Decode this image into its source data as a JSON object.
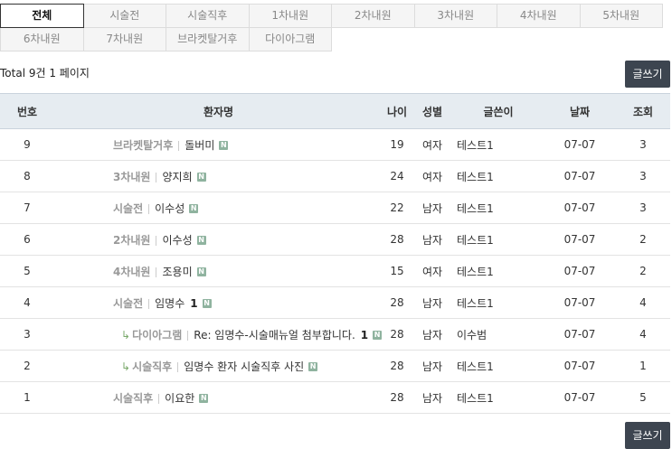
{
  "tabs": {
    "row1": [
      "전체",
      "시술전",
      "시술직후",
      "1차내원",
      "2차내원",
      "3차내원",
      "4차내원",
      "5차내원"
    ],
    "row2": [
      "6차내원",
      "7차내원",
      "브라켓탈거후",
      "다이아그램"
    ]
  },
  "total": "Total 9건 1 페이지",
  "write_button": "글쓰기",
  "table": {
    "headers": {
      "num": "번호",
      "name": "환자명",
      "age": "나이",
      "sex": "성별",
      "writer": "글쓴이",
      "date": "날짜",
      "views": "조회"
    },
    "rows": [
      {
        "num": "9",
        "cat": "브라켓탈거후",
        "title": "돌버미",
        "comments": "",
        "age": "19",
        "sex": "여자",
        "writer": "테스트1",
        "date": "07-07",
        "views": "3",
        "reply": false
      },
      {
        "num": "8",
        "cat": "3차내원",
        "title": "양지희",
        "comments": "",
        "age": "24",
        "sex": "여자",
        "writer": "테스트1",
        "date": "07-07",
        "views": "3",
        "reply": false
      },
      {
        "num": "7",
        "cat": "시술전",
        "title": "이수성",
        "comments": "",
        "age": "22",
        "sex": "남자",
        "writer": "테스트1",
        "date": "07-07",
        "views": "3",
        "reply": false
      },
      {
        "num": "6",
        "cat": "2차내원",
        "title": "이수성",
        "comments": "",
        "age": "28",
        "sex": "남자",
        "writer": "테스트1",
        "date": "07-07",
        "views": "2",
        "reply": false
      },
      {
        "num": "5",
        "cat": "4차내원",
        "title": "조용미",
        "comments": "",
        "age": "15",
        "sex": "여자",
        "writer": "테스트1",
        "date": "07-07",
        "views": "2",
        "reply": false
      },
      {
        "num": "4",
        "cat": "시술전",
        "title": "임명수",
        "comments": "1",
        "age": "28",
        "sex": "남자",
        "writer": "테스트1",
        "date": "07-07",
        "views": "4",
        "reply": false
      },
      {
        "num": "3",
        "cat": "다이아그램",
        "title": "Re: 임명수-시술매뉴얼 첨부합니다.",
        "comments": "1",
        "age": "28",
        "sex": "남자",
        "writer": "이수범",
        "date": "07-07",
        "views": "4",
        "reply": true
      },
      {
        "num": "2",
        "cat": "시술직후",
        "title": "임명수 환자 시술직후 사진",
        "comments": "",
        "age": "28",
        "sex": "남자",
        "writer": "테스트1",
        "date": "07-07",
        "views": "1",
        "reply": true
      },
      {
        "num": "1",
        "cat": "시술직후",
        "title": "이요한",
        "comments": "",
        "age": "28",
        "sex": "남자",
        "writer": "테스트1",
        "date": "07-07",
        "views": "5",
        "reply": false
      }
    ]
  },
  "new_icon_label": "N"
}
